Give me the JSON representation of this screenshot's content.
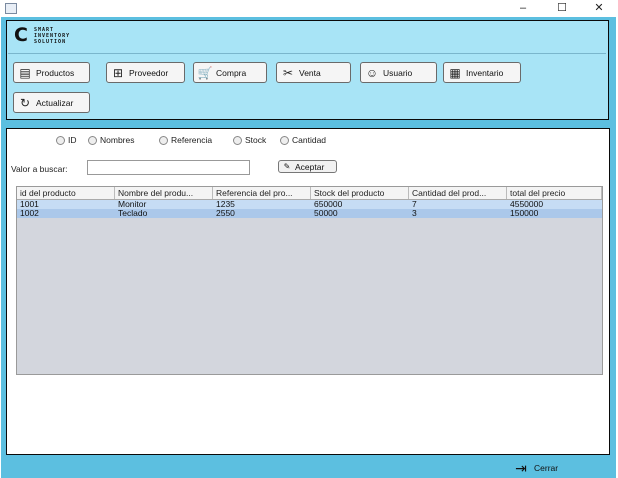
{
  "window": {
    "controls": {
      "minimize": "–",
      "maximize": "☐",
      "close": "✕"
    }
  },
  "logo": {
    "lines": [
      "SMART",
      "INVENTORY",
      "SOLUTION"
    ]
  },
  "toolbar": {
    "productos": "Productos",
    "proveedor": "Proveedor",
    "compra": "Compra",
    "venta": "Venta",
    "usuario": "Usuario",
    "inventario": "Inventario",
    "actualizar": "Actualizar"
  },
  "filters": {
    "id": "ID",
    "nombres": "Nombres",
    "referencia": "Referencia",
    "stock": "Stock",
    "cantidad": "Cantidad"
  },
  "search": {
    "label": "Valor a buscar:",
    "value": "",
    "placeholder": "",
    "accept": "Aceptar"
  },
  "table": {
    "headers": [
      "id del producto",
      "Nombre del produ...",
      "Referencia del pro...",
      "Stock del producto",
      "Cantidad del prod...",
      "total del precio"
    ],
    "rows": [
      [
        "1001",
        "Monitor",
        "1235",
        "650000",
        "7",
        "4550000"
      ],
      [
        "1002",
        "Teclado",
        "2550",
        "50000",
        "3",
        "150000"
      ]
    ]
  },
  "footer": {
    "close": "Cerrar"
  },
  "colors": {
    "frame": "#5cbfe0",
    "top_panel": "#a8e4f6",
    "row_selected": "#abc8ea",
    "table_bg": "#d3d6dd"
  }
}
